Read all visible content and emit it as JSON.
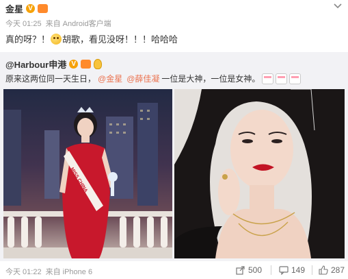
{
  "post": {
    "author": "金星",
    "meta": {
      "time": "今天 01:25",
      "source_prefix": "来自",
      "source": "Android客户端"
    },
    "text_before": "真的呀？！",
    "text_after": "胡歌，看见没呀！！！哈哈哈"
  },
  "repost": {
    "author": "@Harbour申港",
    "text_lead": "原来这两位同一天生日，",
    "mention_1": "@金星",
    "mention_2": "@薛佳凝",
    "text_tail": "一位是大神，一位是女神。",
    "photo_left_caption": "MISS CHINA",
    "footer": {
      "time": "今天 01:22",
      "source_prefix": "来自",
      "source": "iPhone 6"
    },
    "actions": {
      "repost": "500",
      "comment": "149",
      "like": "287"
    }
  },
  "colors": {
    "accent": "#eb7350",
    "repost_bg": "#f2f2f5",
    "muted": "#999999"
  },
  "icons": [
    "verified-v-icon",
    "level-badge-icon",
    "chevron-down-icon",
    "laugh-emoji-icon",
    "lightbulb-icon",
    "cake-icon",
    "share-icon",
    "comment-icon",
    "like-icon"
  ]
}
